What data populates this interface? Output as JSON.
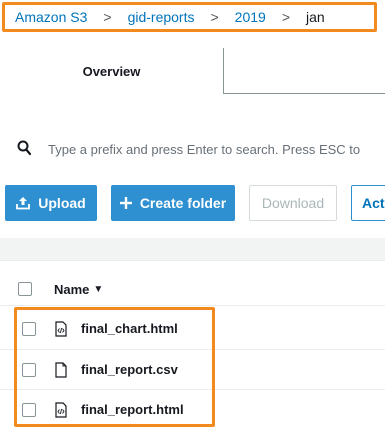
{
  "breadcrumb": {
    "items": [
      {
        "label": "Amazon S3"
      },
      {
        "label": "gid-reports"
      },
      {
        "label": "2019"
      }
    ],
    "current": "jan",
    "separator": ">"
  },
  "tabs": {
    "overview": "Overview"
  },
  "search": {
    "placeholder": "Type a prefix and press Enter to search. Press ESC to"
  },
  "toolbar": {
    "upload": "Upload",
    "create_folder": "Create folder",
    "download": "Download",
    "actions": "Act"
  },
  "table": {
    "column_name": "Name",
    "rows": [
      {
        "name": "final_chart.html",
        "icon": "code-file-icon"
      },
      {
        "name": "final_report.csv",
        "icon": "file-icon"
      },
      {
        "name": "final_report.html",
        "icon": "code-file-icon"
      }
    ]
  },
  "colors": {
    "accent_link": "#0073bb",
    "primary_button": "#2e90d0",
    "highlight": "#f28a1e"
  }
}
